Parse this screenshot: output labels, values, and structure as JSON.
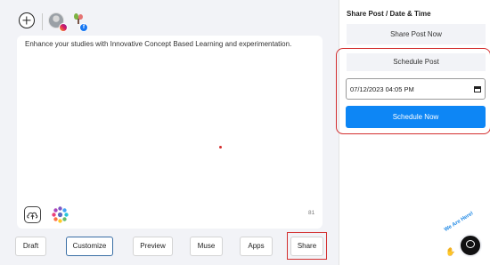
{
  "post": {
    "content": "Enhance your studies with Innovative Concept Based Learning and experimentation.",
    "char_count": "81"
  },
  "actions": {
    "draft": "Draft",
    "customize": "Customize",
    "preview": "Preview",
    "muse": "Muse",
    "apps": "Apps",
    "share": "Share"
  },
  "share_panel": {
    "title": "Share Post / Date & Time",
    "share_now": "Share Post Now",
    "schedule_post": "Schedule Post",
    "datetime_value": "07/12/2023 04:05 PM",
    "schedule_now": "Schedule Now"
  },
  "chat": {
    "label": "We Are Here!"
  },
  "colors": {
    "primary": "#0d86f5",
    "highlight": "#d32f2f",
    "active_border": "#3a6ea5"
  }
}
